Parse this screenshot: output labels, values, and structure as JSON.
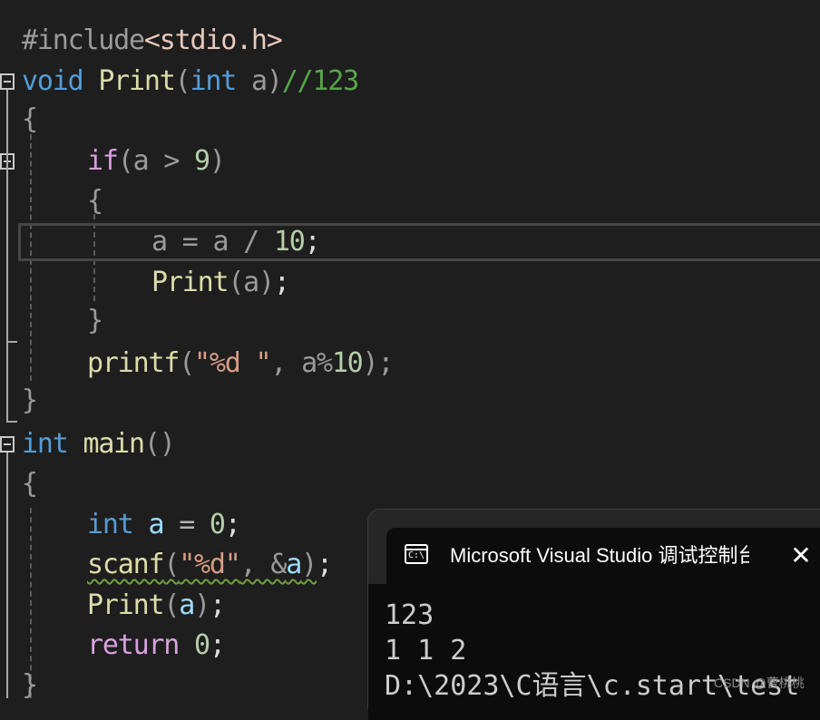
{
  "code": {
    "l1": {
      "a": "#include",
      "b": "<stdio.h>"
    },
    "l2": {
      "a": "void",
      "b": " Print",
      "c": "(",
      "d": "int",
      "e": " a)",
      "f": "//123"
    },
    "l3": {
      "a": "{"
    },
    "l4": {
      "a": "if",
      "b": "(a > ",
      "c": "9",
      "d": ")"
    },
    "l5": {
      "a": "{"
    },
    "l6": {
      "a": "a = a / ",
      "b": "10",
      "c": ";"
    },
    "l7": {
      "a": "Print",
      "b": "(a)",
      "c": ";"
    },
    "l8": {
      "a": "}"
    },
    "l9": {
      "a": "printf",
      "b": "(",
      "c": "\"%d \"",
      "d": ", a%",
      "e": "10",
      "f": ");"
    },
    "l10": {
      "a": "}"
    },
    "l11": {
      "a": "int",
      "b": " main",
      "c": "()"
    },
    "l12": {
      "a": "{"
    },
    "l13": {
      "a": "int",
      "b": " a",
      "c": " = ",
      "d": "0",
      "e": ";"
    },
    "l14": {
      "a": "scanf",
      "b": "(",
      "c": "\"%d\"",
      "d": ", &",
      "e": "a",
      "f": ")",
      "g": ";"
    },
    "l15": {
      "a": "Print",
      "b": "(",
      "c": "a",
      "d": ")",
      "e": ";"
    },
    "l16": {
      "a": "return",
      "b": " ",
      "c": "0",
      "d": ";"
    },
    "l17": {
      "a": "}"
    }
  },
  "console": {
    "title": "Microsoft Visual Studio 调试控制台",
    "icon_label": "C:\\",
    "close_label": "✕",
    "lines": [
      "123",
      "1 1 2",
      "D:\\2023\\C语言\\c.start\\test"
    ]
  },
  "watermark": "CSDN @曹桃桃",
  "icons": {
    "fold": "collapse-icon",
    "console": "console-icon",
    "close": "close-icon"
  }
}
